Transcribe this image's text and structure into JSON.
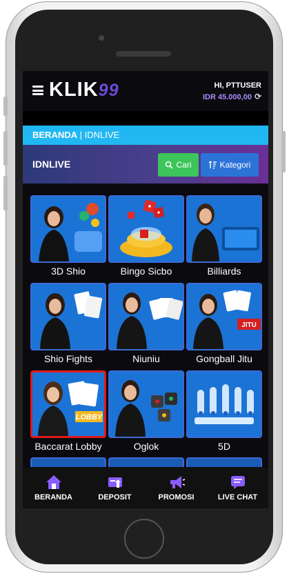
{
  "header": {
    "logo_main": "KLIK",
    "logo_num": "99",
    "greeting": "HI, PTTUSER",
    "balance": "IDR 45.000,00"
  },
  "breadcrumb": {
    "home": "BERANDA",
    "sep": "|",
    "current": "IDNLIVE"
  },
  "section": {
    "title": "IDNLIVE",
    "search_label": "Cari",
    "category_label": "Kategori"
  },
  "games": [
    {
      "label": "3D Shio",
      "icon": "dealer-with-lottery-balls"
    },
    {
      "label": "Bingo Sicbo",
      "icon": "dice-bowl"
    },
    {
      "label": "Billiards",
      "icon": "dealer-with-pool-table"
    },
    {
      "label": "Shio Fights",
      "icon": "dealer-with-cards"
    },
    {
      "label": "Niuniu",
      "icon": "dealer-with-cards"
    },
    {
      "label": "Gongball Jitu",
      "icon": "dealer-with-cards-jitu"
    },
    {
      "label": "Baccarat Lobby",
      "icon": "dealer-with-cards-lobby",
      "selected": true
    },
    {
      "label": "Oglok",
      "icon": "dealer-with-dice"
    },
    {
      "label": "5D",
      "icon": "lottery-machines"
    }
  ],
  "nav": [
    {
      "label": "BERANDA",
      "icon": "home-icon"
    },
    {
      "label": "DEPOSIT",
      "icon": "deposit-icon"
    },
    {
      "label": "PROMOSI",
      "icon": "megaphone-icon"
    },
    {
      "label": "LIVE CHAT",
      "icon": "chat-icon"
    }
  ],
  "colors": {
    "accent_blue": "#20b7f2",
    "search_green": "#3bc55a",
    "category_blue": "#2c73d8",
    "nav_purple": "#7c4dff"
  }
}
